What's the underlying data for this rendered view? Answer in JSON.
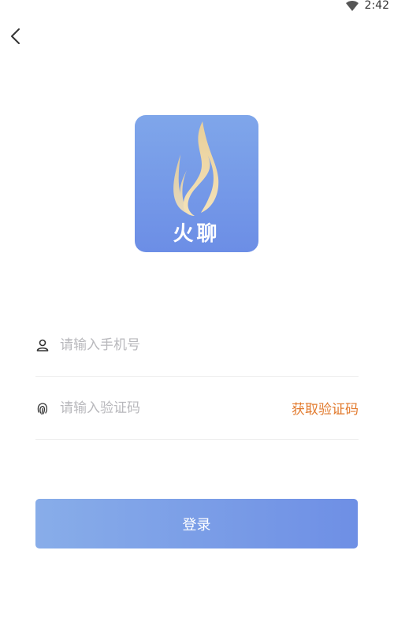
{
  "status_bar": {
    "time": "2:42",
    "wifi_icon": "wifi-icon"
  },
  "nav": {
    "back_icon": "chevron-left-icon"
  },
  "logo": {
    "text": "火聊",
    "icon": "flame-icon",
    "bg_color": "#6f92e6"
  },
  "form": {
    "phone": {
      "placeholder": "请输入手机号",
      "value": "",
      "icon": "user-icon"
    },
    "code": {
      "placeholder": "请输入验证码",
      "value": "",
      "icon": "fingerprint-icon",
      "get_code_label": "获取验证码"
    },
    "login_label": "登录"
  },
  "colors": {
    "accent": "#e27a2d",
    "button_start": "#88ade9",
    "button_end": "#6e8fe5",
    "placeholder": "#b8b8bc"
  }
}
